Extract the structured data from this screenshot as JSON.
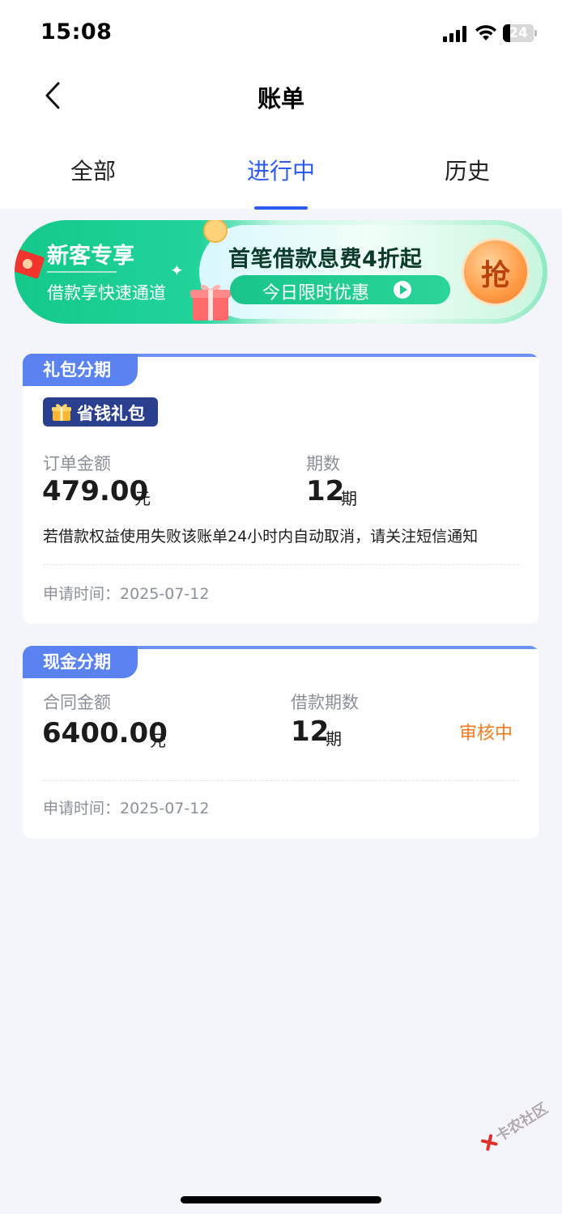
{
  "status_bar": {
    "time": "15:08",
    "battery": "24"
  },
  "nav": {
    "title": "账单"
  },
  "tabs": [
    {
      "label": "全部",
      "active": false
    },
    {
      "label": "进行中",
      "active": true
    },
    {
      "label": "历史",
      "active": false
    }
  ],
  "banner": {
    "title": "新客专享",
    "subtitle": "借款享快速通道",
    "headline": "首笔借款息费4折起",
    "pill_text": "今日限时优惠",
    "grab_text": "抢"
  },
  "cards": [
    {
      "tag": "礼包分期",
      "badge": "省钱礼包",
      "left_label": "订单金额",
      "left_value": "479.00",
      "left_unit": "元",
      "right_label": "期数",
      "right_value": "12",
      "right_unit": "期",
      "notice": "若借款权益使用失败该账单24小时内自动取消，请关注短信通知",
      "apply_time": "申请时间：2025-07-12"
    },
    {
      "tag": "现金分期",
      "left_label": "合同金额",
      "left_value": "6400.00",
      "left_unit": "元",
      "right_label": "借款期数",
      "right_value": "12",
      "right_unit": "期",
      "status": "审核中",
      "apply_time": "申请时间：2025-07-12"
    }
  ],
  "watermark": {
    "text": "卡农社区"
  },
  "colors": {
    "accent": "#2d5bf0",
    "tag": "#5b82f1",
    "status": "#f57a1e",
    "background": "#f3f5fa"
  }
}
